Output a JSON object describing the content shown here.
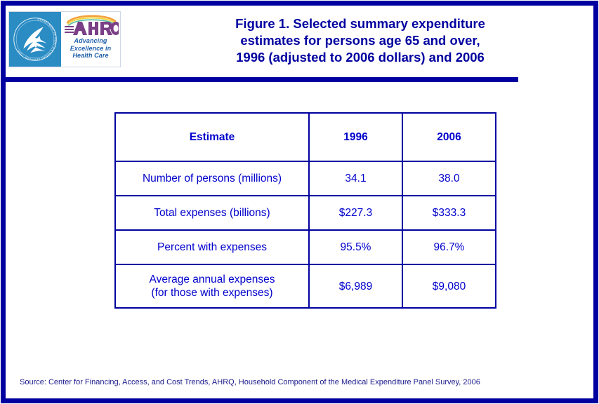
{
  "figure": {
    "title_lines": [
      "Figure 1. Selected summary expenditure",
      "estimates for persons age 65 and over,",
      "1996 (adjusted to 2006 dollars) and 2006"
    ],
    "source": "Source: Center for Financing, Access, and Cost Trends, AHRQ, Household Component of the Medical Expenditure Panel Survey, 2006"
  },
  "logo": {
    "agency_acronym": "AHRQ",
    "tagline_lines": [
      "Advancing",
      "Excellence in",
      "Health Care"
    ],
    "seal_ring_text": "DEPARTMENT OF HEALTH & HUMAN SERVICES · USA"
  },
  "colors": {
    "navy": "#0000a0",
    "text_blue": "#0000cc",
    "seal_blue": "#2b8cc4",
    "ahrq_purple": "#7a3f86",
    "tagline_blue": "#1f5fa9",
    "source_blue": "#1a1a8c"
  },
  "chart_data": {
    "type": "table",
    "title": "Figure 1. Selected summary expenditure estimates for persons age 65 and over, 1996 (adjusted to 2006 dollars) and 2006",
    "columns": [
      "Estimate",
      "1996",
      "2006"
    ],
    "rows": [
      {
        "label": "Number of persons (millions)",
        "label_lines": [
          "Number of persons (millions)"
        ],
        "v1996": "34.1",
        "v2006": "38.0"
      },
      {
        "label": "Total expenses (billions)",
        "label_lines": [
          "Total expenses (billions)"
        ],
        "v1996": "$227.3",
        "v2006": "$333.3"
      },
      {
        "label": "Percent with expenses",
        "label_lines": [
          "Percent with expenses"
        ],
        "v1996": "95.5%",
        "v2006": "96.7%"
      },
      {
        "label": "Average annual expenses (for those with expenses)",
        "label_lines": [
          "Average annual expenses",
          "(for those with expenses)"
        ],
        "v1996": "$6,989",
        "v2006": "$9,080"
      }
    ],
    "xlabel": "",
    "ylabel": "",
    "legend": []
  }
}
